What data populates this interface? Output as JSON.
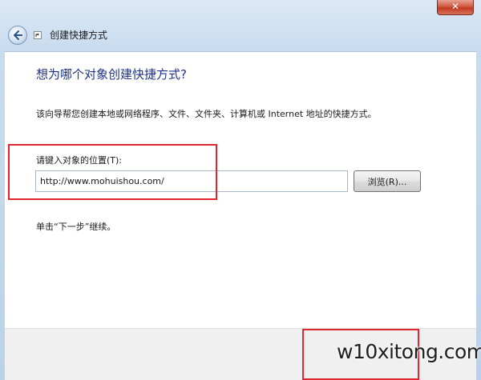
{
  "window": {
    "close_label": "✕"
  },
  "nav": {
    "title": "创建快捷方式"
  },
  "main": {
    "heading": "想为哪个对象创建快捷方式?",
    "description": "该向导帮您创建本地或网络程序、文件、文件夹、计算机或 Internet 地址的快捷方式。",
    "location_label": "请键入对象的位置(T):",
    "location_value": "http://www.mohuishou.com/",
    "browse_label": "浏览(R)...",
    "continue_text": "单击“下一步”继续。"
  },
  "watermark": {
    "text": "w10xitong.com"
  },
  "colors": {
    "highlight": "#e0262f",
    "heading": "#1e3287"
  },
  "icons": {
    "back": "back-arrow-icon",
    "shortcut": "shortcut-icon",
    "close": "close-icon"
  }
}
